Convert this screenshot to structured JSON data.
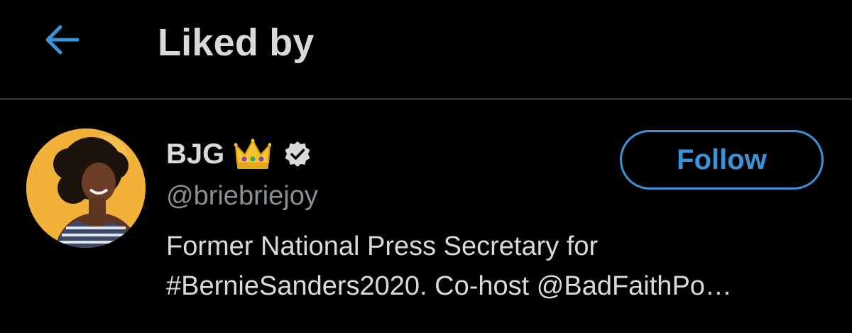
{
  "header": {
    "title": "Liked by",
    "back_icon": "arrow-left-icon"
  },
  "user": {
    "display_name": "BJG",
    "name_emoji": "crown-icon",
    "verified_icon": "verified-badge-icon",
    "handle": "@briebriejoy",
    "bio_lines": [
      "Former National Press Secretary for",
      "#BernieSanders2020. Co-host @BadFaithPo…"
    ],
    "follow_label": "Follow"
  },
  "colors": {
    "background": "#000000",
    "accent": "#3a94d9",
    "primary_text": "#d9d9d9",
    "secondary_text": "#8a8f94",
    "divider": "#2b2b2b"
  }
}
